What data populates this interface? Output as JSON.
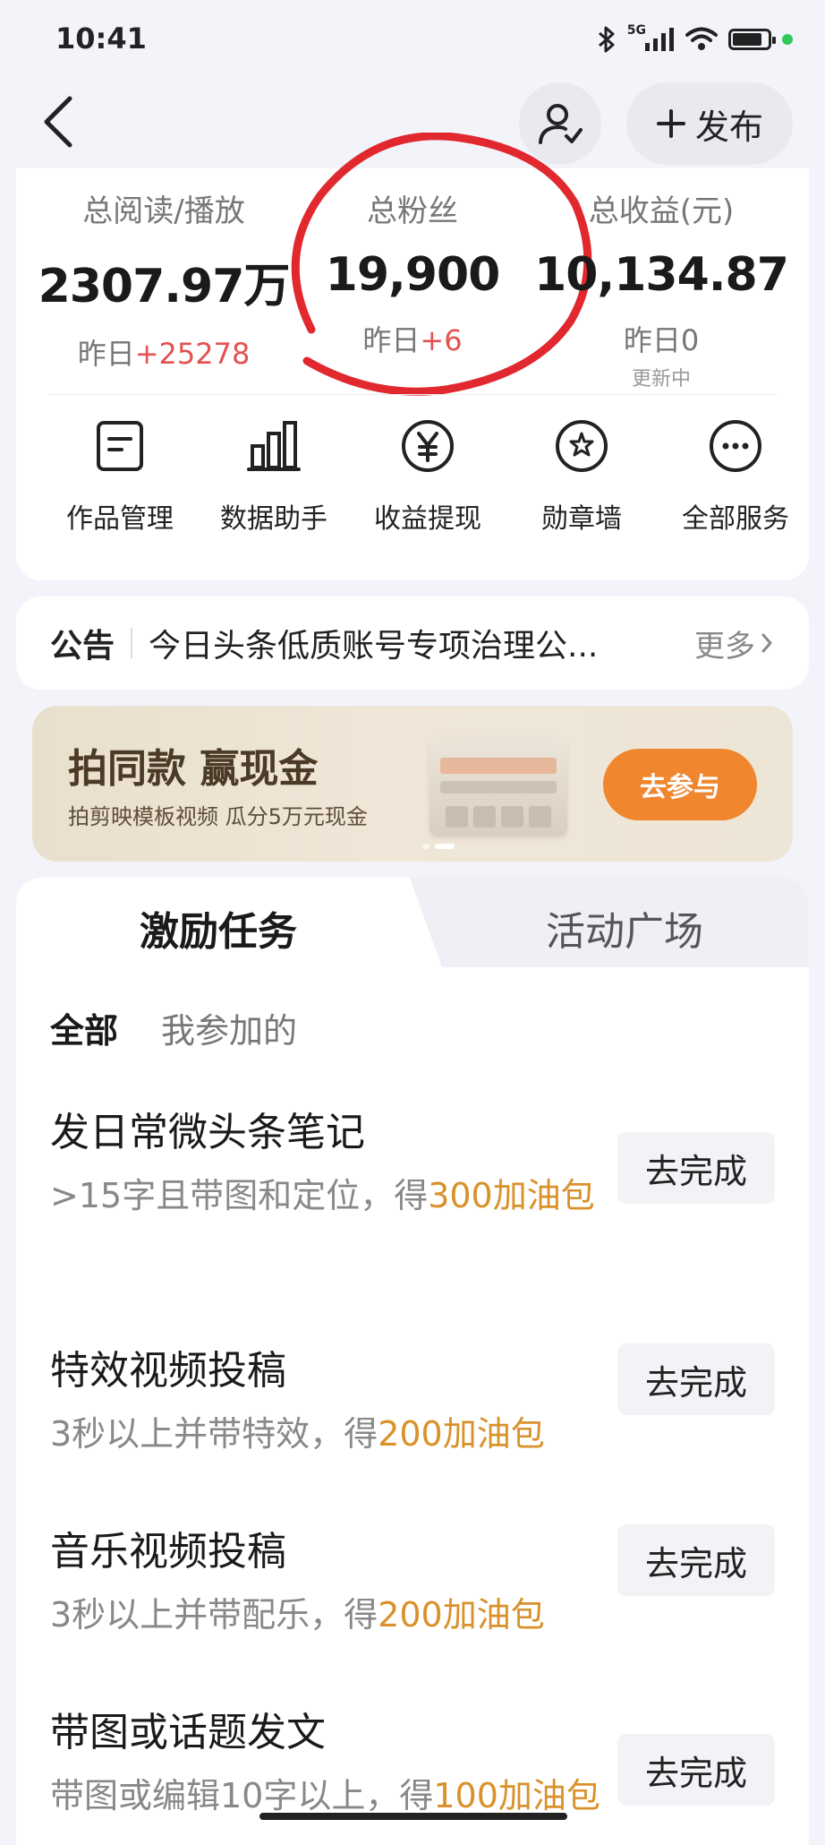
{
  "status_bar": {
    "time": "10:41",
    "network": "5G",
    "battery_level": 0.85
  },
  "header": {
    "back_icon": "chevron-left-icon",
    "profile_icon": "user-check-icon",
    "publish_label": "发布"
  },
  "stats": [
    {
      "label": "总阅读/播放",
      "value": "2307.97万",
      "sub_prefix": "昨日",
      "sub_value": "+25278",
      "note": ""
    },
    {
      "label": "总粉丝",
      "value": "19,900",
      "sub_prefix": "昨日",
      "sub_value": "+6",
      "note": ""
    },
    {
      "label": "总收益(元)",
      "value": "10,134.87",
      "sub_prefix": "昨日",
      "sub_value": "0",
      "note": "更新中"
    }
  ],
  "services": [
    {
      "label": "作品管理",
      "icon": "document-icon"
    },
    {
      "label": "数据助手",
      "icon": "bar-chart-icon"
    },
    {
      "label": "收益提现",
      "icon": "yen-icon"
    },
    {
      "label": "勋章墙",
      "icon": "medal-icon"
    },
    {
      "label": "全部服务",
      "icon": "more-icon"
    }
  ],
  "notice": {
    "label": "公告",
    "text": "今日头条低质账号专项治理公...",
    "more": "更多"
  },
  "banner": {
    "title": "拍同款 赢现金",
    "subtitle": "拍剪映模板视频 瓜分5万元现金",
    "button": "去参与"
  },
  "tasks_section": {
    "tabs": [
      "激励任务",
      "活动广场"
    ],
    "filters": [
      "全部",
      "我参加的"
    ],
    "items": [
      {
        "title": "发日常微头条笔记",
        "desc_prefix": ">15字且带图和定位，得",
        "reward": "300加油包",
        "button": "去完成"
      },
      {
        "title": "特效视频投稿",
        "desc_prefix": "3秒以上并带特效，得",
        "reward": "200加油包",
        "button": "去完成"
      },
      {
        "title": "音乐视频投稿",
        "desc_prefix": "3秒以上并带配乐，得",
        "reward": "200加油包",
        "button": "去完成"
      },
      {
        "title": "带图或话题发文",
        "desc_prefix": "带图或编辑10字以上，得",
        "reward": "100加油包",
        "button": "去完成"
      }
    ]
  },
  "colors": {
    "background": "#f3f4f9",
    "positive_red": "#e35151",
    "reward_orange": "#d9912a",
    "banner_button": "#f0872f"
  }
}
